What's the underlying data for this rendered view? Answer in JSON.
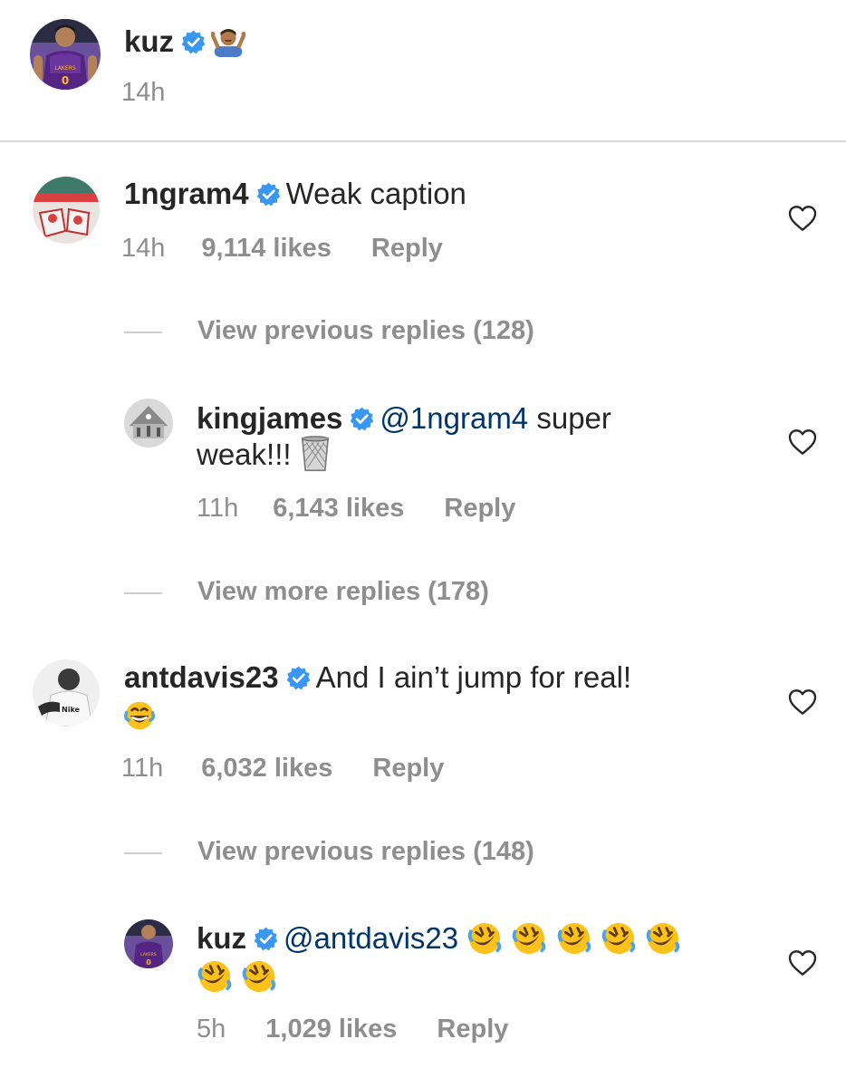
{
  "post": {
    "username": "kuz",
    "caption_emoji": "person-shrugging-emoji",
    "time": "14h"
  },
  "comments": [
    {
      "username": "1ngram4",
      "text": "Weak caption",
      "time": "14h",
      "likes": "9,114 likes",
      "reply_label": "Reply",
      "view_label": "View previous replies (128)"
    },
    {
      "username": "kingjames",
      "mention": "@1ngram4",
      "text_line1": "super",
      "text_line2": "weak!!!",
      "emoji": "wastebasket-emoji",
      "time": "11h",
      "likes": "6,143 likes",
      "reply_label": "Reply",
      "view_label": "View more replies (178)"
    },
    {
      "username": "antdavis23",
      "text": "And I ain’t jump for real!",
      "emoji": "face-with-tears-of-joy-emoji",
      "time": "11h",
      "likes": "6,032 likes",
      "reply_label": "Reply",
      "view_label": "View previous replies (148)"
    },
    {
      "username": "kuz",
      "mention": "@antdavis23",
      "emoji": "rolling-on-the-floor-laughing-emoji",
      "emoji_count": 7,
      "time": "5h",
      "likes": "1,029 likes",
      "reply_label": "Reply"
    }
  ],
  "colors": {
    "verified": "#3897f0",
    "mention": "#003569",
    "meta": "#8e8e8e"
  }
}
